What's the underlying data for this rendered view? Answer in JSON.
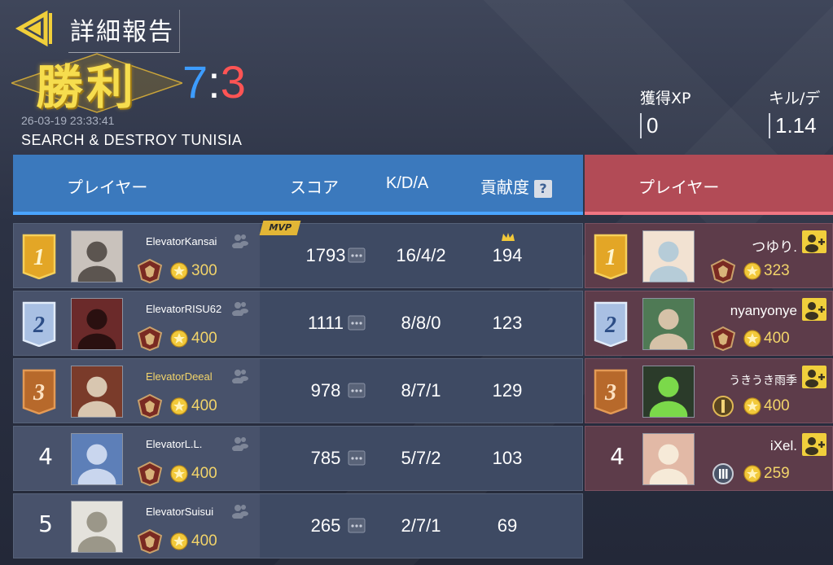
{
  "header": {
    "title": "詳細報告",
    "result": "勝利",
    "score_blue": "7",
    "score_sep": ":",
    "score_red": "3",
    "timestamp": "26-03-19 23:33:41",
    "mode": "SEARCH & DESTROY   TUNISIA"
  },
  "stats": {
    "xp_label": "獲得XP",
    "xp_value": "0",
    "kd_label": "キル/デ",
    "kd_value": "1.14"
  },
  "blue_header": {
    "player": "プレイヤー",
    "score": "スコア",
    "kda": "K/D/A",
    "contrib": "貢献度",
    "help": "?"
  },
  "red_header": {
    "player": "プレイヤー"
  },
  "mvp_label": "MVP",
  "blue_players": [
    {
      "rank": "1",
      "name": "ElevatorKansai",
      "level": "300",
      "score": "1793",
      "kda": "16/4/2",
      "contrib": "194"
    },
    {
      "rank": "2",
      "name": "ElevatorRISU62",
      "level": "400",
      "score": "1111",
      "kda": "8/8/0",
      "contrib": "123"
    },
    {
      "rank": "3",
      "name": "ElevatorDeeal",
      "level": "400",
      "score": "978",
      "kda": "8/7/1",
      "contrib": "129"
    },
    {
      "rank": "4",
      "name": "ElevatorL.L.",
      "level": "400",
      "score": "785",
      "kda": "5/7/2",
      "contrib": "103"
    },
    {
      "rank": "5",
      "name": "ElevatorSuisui",
      "level": "400",
      "score": "265",
      "kda": "2/7/1",
      "contrib": "69"
    }
  ],
  "red_players": [
    {
      "rank": "1",
      "name": "つゆり.",
      "level": "323"
    },
    {
      "rank": "2",
      "name": "nyanyonye",
      "level": "400"
    },
    {
      "rank": "3",
      "name": "うきうき雨季",
      "level": "400"
    },
    {
      "rank": "4",
      "name": "iXel.",
      "level": "259"
    }
  ],
  "colors": {
    "blue_team": "#3b79bd",
    "red_team": "#b24b56",
    "gold": "#f2d46a",
    "score_blue": "#3d9cff",
    "score_red": "#ff5454"
  }
}
